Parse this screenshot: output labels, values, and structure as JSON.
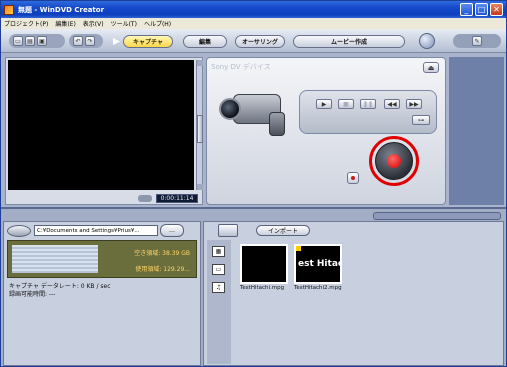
{
  "window": {
    "title": "無題 - WinDVD Creator"
  },
  "menu": [
    "プロジェクト(P)",
    "編集(E)",
    "表示(V)",
    "ツール(T)",
    "ヘルプ(H)"
  ],
  "toolbar": {
    "tabs": [
      {
        "label": "キャプチャ",
        "active": true
      },
      {
        "label": "編集",
        "active": false
      },
      {
        "label": "オーサリング",
        "active": false
      },
      {
        "label": "ムービー作成",
        "active": false
      }
    ]
  },
  "preview": {
    "timecode": "0:00:11:14"
  },
  "device": {
    "title": "Sony DV デバイス",
    "eject_icon": "eject-icon"
  },
  "transport": {
    "play": "▶",
    "stop": "■",
    "pause": "❚❚",
    "rewind": "◀◀",
    "ffwd": "▶▶",
    "extra": "⊶"
  },
  "storage": {
    "path": "C:¥Documents and Settings¥Prius¥...",
    "browse_label": "…",
    "free_label": "空き領域: 38.39 GB",
    "used_label": "使用領域: 129.29..."
  },
  "capture_info": {
    "data_rate": "キャプチャ データレート: 0 KB / sec",
    "record_time": "録画可能時間: ---"
  },
  "library": {
    "import_label": "インポート",
    "items": [
      {
        "name": "TestHitachi.mpg",
        "preview_text": ""
      },
      {
        "name": "TestHitachi2.mpg",
        "preview_text": "est Hitach"
      }
    ]
  }
}
